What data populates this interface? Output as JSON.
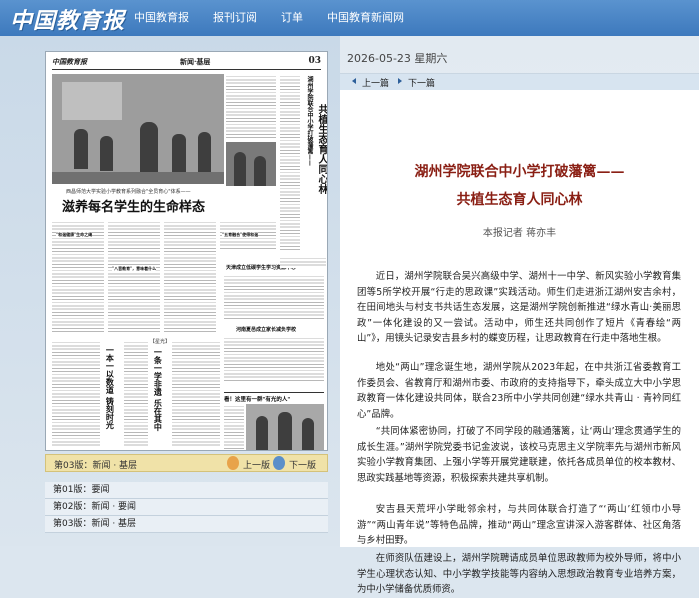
{
  "site": {
    "logo_text": "中国教育报",
    "nav": [
      "中国教育报",
      "报刊订阅",
      "订单",
      "中国教育新闻网"
    ]
  },
  "paper": {
    "masthead": "中国教育报",
    "section": "新闻·基层",
    "page_no": "03",
    "headline_sub": "西昌师范大学实验小学教育系列融合\"全员育心\"体系——",
    "headline_main": "滋养每名学生的生命样态",
    "vertical_title_1": "湖州学院联合中小学打破藩篱——",
    "vertical_title_2": "共植生态育人同心林",
    "col_head_1": "\"和谐健康\"生命之绳",
    "col_head_2": "\"八音教育\"，意味着什么",
    "col_head_3": "\"五育融合\"使得和谐",
    "sidebar_1": "天津成立低碳学生学习资源中心",
    "sidebar_2": "河南夏邑成立家长减负学校",
    "kicker_1": "一本一以数道 铸刻时光",
    "kicker_2": "一条一学非遗 乐在其中",
    "kicker_box": "看！这里有一群\"有光的人\"",
    "kicker_head": "【星光】"
  },
  "pagination": {
    "current": "第03版：新闻 · 基层",
    "prev": "上一版",
    "next": "下一版"
  },
  "page_list": [
    "第01版：要闻",
    "第02版：新闻 · 要闻",
    "第03版：新闻 · 基层"
  ],
  "article": {
    "date": "2026-05-23  星期六",
    "prev": "上一篇",
    "next": "下一篇",
    "title_line1": "湖州学院联合中小学打破藩篱——",
    "title_line2": "共植生态育人同心林",
    "byline": "本报记者  蒋亦丰",
    "paragraphs": [
      "近日，湖州学院联合吴兴高级中学、湖州十一中学、新风实验小学教育集团等5所学校开展“行走的思政课”实践活动。师生们走进浙江湖州安吉余村，在田间地头与村支书共话生态发展，这是湖州学院创新推进“绿水青山·美丽思政”一体化建设的又一尝试。活动中，师生还共同创作了短片《青春绘“两山”》，用镜头记录安吉县乡村的蝶变历程，让思政教育在行走中落地生根。",
      "地处“两山”理念诞生地，湖州学院从2023年起，在中共浙江省委教育工作委员会、省教育厅和湖州市委、市政府的支持指导下，牵头成立大中小学思政教育一体化建设共同体，联合23所中小学共同创建“绿水共青山 · 青衿同红心”品牌。",
      "“共同体紧密协同，打破了不同学段的融通藩篱，让‘两山’理念贯通学生的成长生涯。”湖州学院党委书记金波说，该校马克思主义学院率先与湖州市新风实验小学教育集团、上强小学等开展党建联建，依托各成员单位的校本教材、思政实践基地等资源，积极探索共建共享机制。",
      "安吉县天荒坪小学毗邻余村，与共同体联合打造了“‘两山’红领巾小导游”“两山青年说”等特色品牌，推动“两山”理念宣讲深入游客群体、社区角落与乡村田野。",
      "在师资队伍建设上，湖州学院聘请成员单位思政教师为校外导师，将中小学生心理状态认知、中小学教学技能等内容纳入思想政治教育专业培养方案，为中小学储备优质师资。"
    ]
  }
}
